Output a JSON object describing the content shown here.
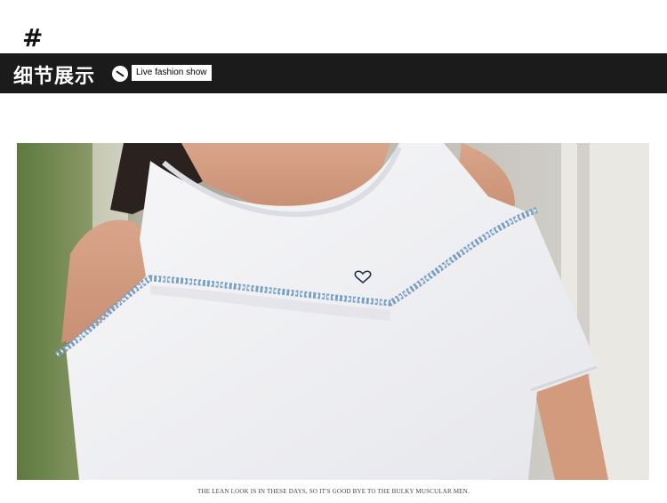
{
  "header": {
    "hash_symbol": "#"
  },
  "banner": {
    "title": "细节展示",
    "tag": "Live fashion show"
  },
  "photo": {
    "subject": "white cold-shoulder t-shirt detail"
  },
  "caption": "THE LEAN LOOK IS IN THESE DAYS, SO IT'S GOOD BYE TO THE BULKY MUSCULAR MEN.",
  "colors": {
    "banner_bg": "#1b1b1b",
    "shirt": "#f4f4f6",
    "denim_trim": "#6f95bd"
  }
}
